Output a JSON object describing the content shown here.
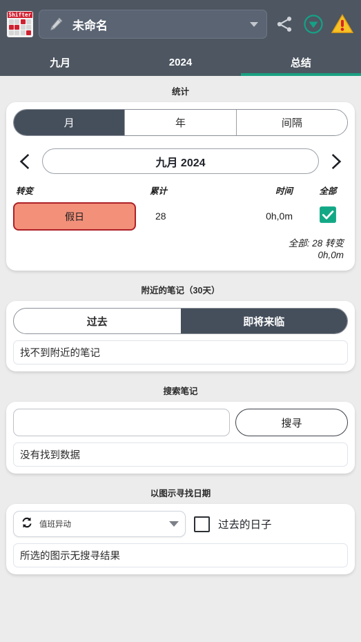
{
  "header": {
    "app_icon_name": "shifter-calendar-logo",
    "app_icon_text": "Shifter",
    "schedule_name": "未命名",
    "pencil_icon": "pencil-icon",
    "dropdown_icon": "chevron-down-icon",
    "share_icon": "share-icon",
    "collapse_icon": "download-circle-icon",
    "warning_icon": "warning-triangle-icon"
  },
  "tabs": [
    {
      "label": "九月",
      "active": false
    },
    {
      "label": "2024",
      "active": false
    },
    {
      "label": "总结",
      "active": true
    }
  ],
  "statistics": {
    "section_title": "统计",
    "range_options": [
      {
        "label": "月",
        "selected": true
      },
      {
        "label": "年",
        "selected": false
      },
      {
        "label": "间隔",
        "selected": false
      }
    ],
    "prev_icon": "chevron-left-icon",
    "next_icon": "chevron-right-icon",
    "period_label": "九月 2024",
    "columns": {
      "shift": "转变",
      "accumulated": "累计",
      "time": "时间",
      "all": "全部"
    },
    "rows": [
      {
        "shift": "假日",
        "accumulated": "28",
        "time": "0h,0m",
        "checked": true,
        "badge_fill": "#f2907a",
        "badge_border": "#ae1f26",
        "check_color": "#12a886"
      }
    ],
    "totals_line1": "全部: 28 转变",
    "totals_line2": "0h,0m"
  },
  "nearby_notes": {
    "section_title": "附近的笔记（30天）",
    "toggle": [
      {
        "label": "过去",
        "selected": false
      },
      {
        "label": "即将来临",
        "selected": true
      }
    ],
    "empty_text": "找不到附近的笔记"
  },
  "search_notes": {
    "section_title": "搜索笔记",
    "input_value": "",
    "input_placeholder": "",
    "button_label": "搜寻",
    "result_text": "没有找到数据"
  },
  "find_by_icon": {
    "section_title": "以图示寻找日期",
    "selected_icon_name": "shift-swap-icon",
    "selected_icon_label": "值班异动",
    "dropdown_icon": "chevron-down-icon",
    "past_days_checkbox_label": "过去的日子",
    "past_days_checked": false,
    "result_text": "所选的图示无搜寻结果"
  },
  "colors": {
    "topbar": "#4d5661",
    "accent_teal": "#1aa182",
    "segment_selected": "#454f5c",
    "page_background": "#ececec",
    "warning_yellow": "#f7c325",
    "warning_red": "#d8232a"
  }
}
